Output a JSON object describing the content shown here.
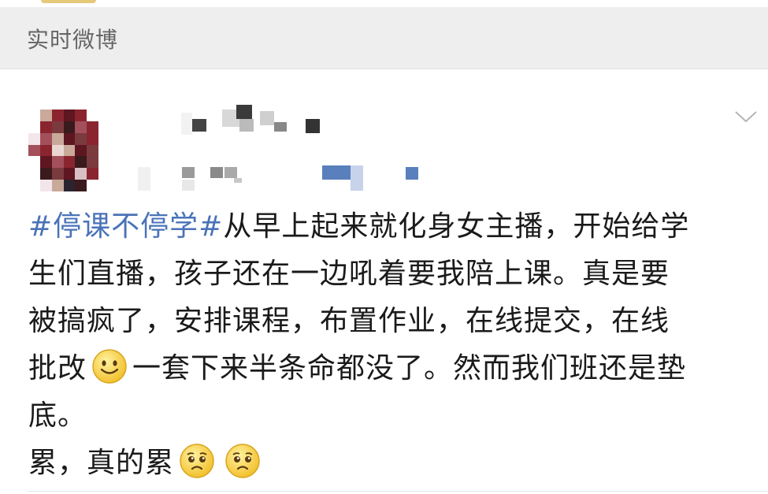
{
  "section": {
    "title": "实时微博"
  },
  "post": {
    "hashtag": "#停课不停学#",
    "line1_rest": "从早上起来就化身女主播，开始给学",
    "line2": "生们直播，孩子还在一边吼着要我陪上课。真是要",
    "line3": "被搞疯了，安排课程，布置作业，在线提交，在线",
    "line4_before_emoji": "批改",
    "line4_after_emoji": "一套下来半条命都没了。然而我们班还是垫",
    "line5": "底。",
    "line6": "累，真的累",
    "emojis": [
      "smile-emoji",
      "sad-emoji",
      "sad-emoji"
    ]
  },
  "icons": {
    "menu": "chevron-down-icon"
  },
  "colors": {
    "hashtag": "#4a73b8",
    "text": "#1a1a1a",
    "header_bg": "#eeeeee",
    "header_text": "#666666"
  }
}
